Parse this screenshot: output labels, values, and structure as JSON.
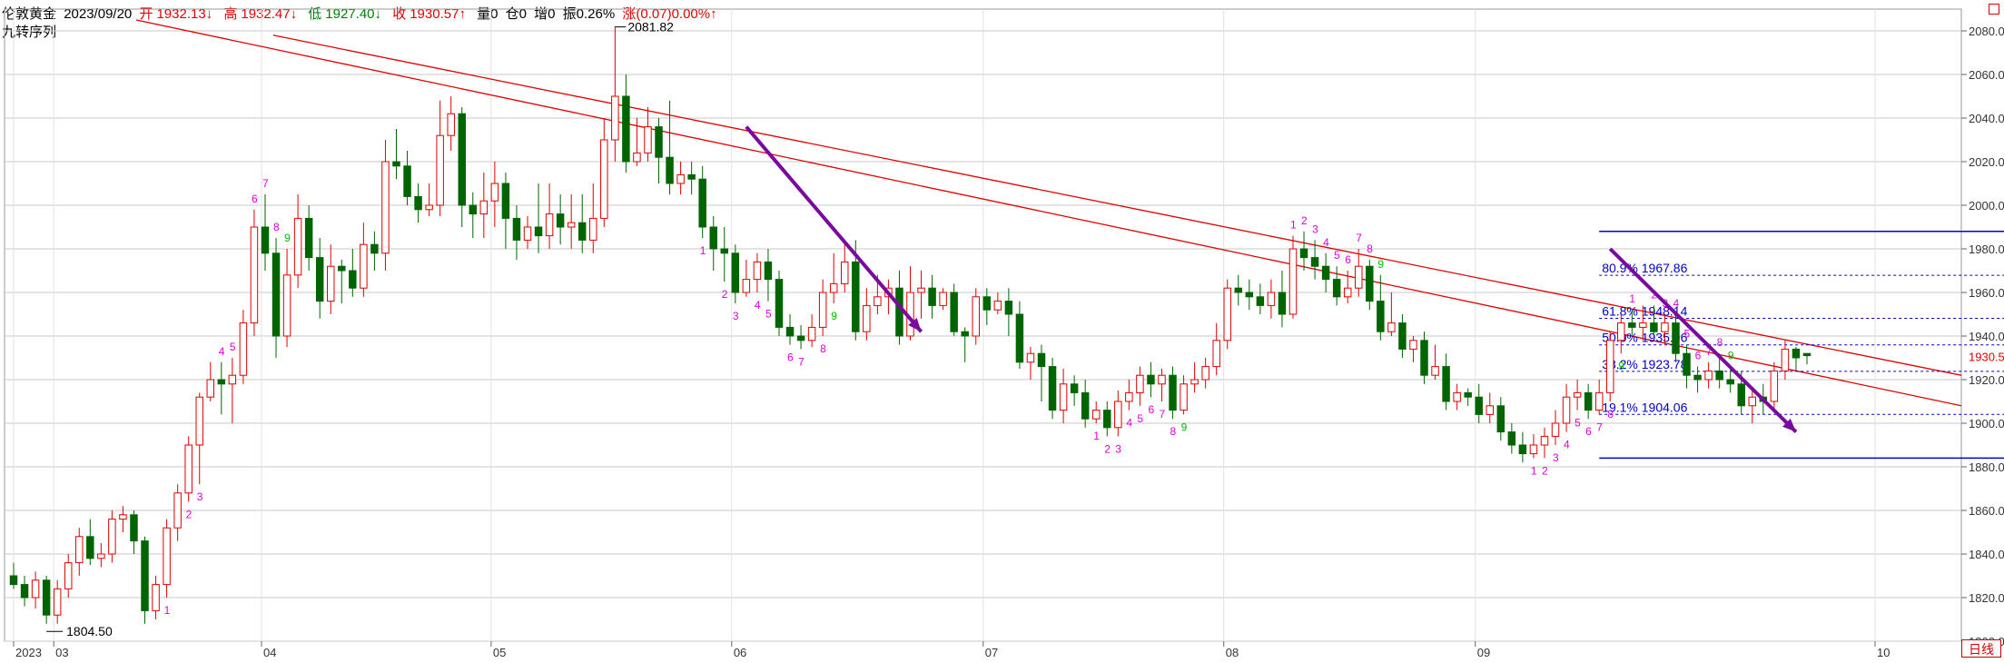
{
  "header": {
    "name": "伦敦黄金",
    "date": "2023/09/20",
    "open_label": "开",
    "open": "1932.13↓",
    "high_label": "高",
    "high": "1932.47↓",
    "low_label": "低",
    "low": "1927.40↓",
    "close_label": "收",
    "close": "1930.57↑",
    "volume": "量0",
    "position": "仓0",
    "increase": "增0",
    "amplitude": "振0.26%",
    "change": "涨(0.07)0.00%↑"
  },
  "indicator_name": "九转序列",
  "period_button": "日线",
  "colors": {
    "up": "#e00000",
    "down": "#006400",
    "trendline": "#e00000",
    "fib": "#0000cc",
    "arrow": "#7a0a9e",
    "td_up": "#e000e0",
    "td_down": "#00c000",
    "grid": "#c8c8c8"
  },
  "chart_data": {
    "type": "candlestick",
    "title": "伦敦黄金",
    "ylim": [
      1800,
      2090
    ],
    "y_ticks": [
      "1800.00",
      "1820.00",
      "1840.00",
      "1860.00",
      "1880.00",
      "1900.00",
      "1920.00",
      "1940.00",
      "1960.00",
      "1980.00",
      "2000.00",
      "2020.00",
      "2040.00",
      "2060.00",
      "2080.00"
    ],
    "x_ticks": [
      "2023",
      "03",
      "04",
      "05",
      "06",
      "07",
      "08",
      "09",
      "10"
    ],
    "last_price": "1930.57",
    "annotations": {
      "high_marker": "2081.82",
      "low_marker": "1804.50"
    },
    "fibonacci": [
      {
        "label": "80.9% 1967.86",
        "value": 1967.86
      },
      {
        "label": "61.8% 1948.14",
        "value": 1948.14
      },
      {
        "label": "50.0% 1935.96",
        "value": 1935.96
      },
      {
        "label": "38.2% 1923.78",
        "value": 1923.78
      },
      {
        "label": "19.1% 1904.06",
        "value": 1904.06
      }
    ],
    "fib_bounds": [
      1884,
      1988
    ],
    "candles": [
      [
        1830,
        1826,
        1836,
        1824
      ],
      [
        1826,
        1820,
        1830,
        1816
      ],
      [
        1820,
        1828,
        1832,
        1815
      ],
      [
        1828,
        1812,
        1830,
        1808
      ],
      [
        1812,
        1824,
        1828,
        1808
      ],
      [
        1824,
        1836,
        1840,
        1820
      ],
      [
        1836,
        1848,
        1852,
        1830
      ],
      [
        1848,
        1838,
        1856,
        1835
      ],
      [
        1838,
        1840,
        1845,
        1834
      ],
      [
        1840,
        1856,
        1860,
        1836
      ],
      [
        1856,
        1858,
        1862,
        1850
      ],
      [
        1858,
        1846,
        1860,
        1840
      ],
      [
        1846,
        1814,
        1848,
        1808
      ],
      [
        1814,
        1826,
        1830,
        1810
      ],
      [
        1826,
        1852,
        1856,
        1820
      ],
      [
        1852,
        1868,
        1872,
        1846
      ],
      [
        1868,
        1890,
        1894,
        1864
      ],
      [
        1890,
        1912,
        1914,
        1872
      ],
      [
        1912,
        1920,
        1928,
        1910
      ],
      [
        1920,
        1918,
        1928,
        1904
      ],
      [
        1918,
        1922,
        1930,
        1900
      ],
      [
        1922,
        1946,
        1952,
        1918
      ],
      [
        1946,
        1990,
        1998,
        1940
      ],
      [
        1990,
        1978,
        2005,
        1970
      ],
      [
        1978,
        1940,
        1985,
        1930
      ],
      [
        1940,
        1968,
        1980,
        1935
      ],
      [
        1968,
        1994,
        2005,
        1962
      ],
      [
        1994,
        1976,
        2000,
        1970
      ],
      [
        1976,
        1956,
        1985,
        1948
      ],
      [
        1956,
        1972,
        1982,
        1950
      ],
      [
        1972,
        1970,
        1975,
        1955
      ],
      [
        1970,
        1962,
        1980,
        1958
      ],
      [
        1962,
        1982,
        1992,
        1958
      ],
      [
        1982,
        1978,
        1988,
        1970
      ],
      [
        1978,
        2020,
        2030,
        1970
      ],
      [
        2020,
        2018,
        2035,
        2012
      ],
      [
        2018,
        2004,
        2025,
        2000
      ],
      [
        2004,
        1998,
        2010,
        1992
      ],
      [
        1998,
        2000,
        2010,
        1995
      ],
      [
        2000,
        2032,
        2048,
        1995
      ],
      [
        2032,
        2042,
        2050,
        2025
      ],
      [
        2042,
        2000,
        2045,
        1990
      ],
      [
        2000,
        1996,
        2006,
        1985
      ],
      [
        1996,
        2002,
        2015,
        1985
      ],
      [
        2002,
        2010,
        2020,
        1990
      ],
      [
        2010,
        1994,
        2015,
        1980
      ],
      [
        1994,
        1984,
        2000,
        1975
      ],
      [
        1984,
        1990,
        1995,
        1980
      ],
      [
        1990,
        1986,
        2010,
        1978
      ],
      [
        1986,
        1996,
        2010,
        1980
      ],
      [
        1996,
        1990,
        2005,
        1982
      ],
      [
        1990,
        1992,
        2005,
        1980
      ],
      [
        1992,
        1984,
        2005,
        1978
      ],
      [
        1984,
        1994,
        2010,
        1978
      ],
      [
        1994,
        2030,
        2040,
        1990
      ],
      [
        2030,
        2050,
        2082,
        2020
      ],
      [
        2050,
        2020,
        2060,
        2015
      ],
      [
        2020,
        2024,
        2040,
        2018
      ],
      [
        2024,
        2036,
        2045,
        2020
      ],
      [
        2036,
        2022,
        2040,
        2010
      ],
      [
        2022,
        2010,
        2048,
        2005
      ],
      [
        2010,
        2014,
        2020,
        2005
      ],
      [
        2014,
        2012,
        2020,
        2005
      ],
      [
        2012,
        1990,
        2018,
        1985
      ],
      [
        1990,
        1980,
        1995,
        1970
      ],
      [
        1980,
        1978,
        1990,
        1965
      ],
      [
        1978,
        1960,
        1982,
        1955
      ],
      [
        1960,
        1966,
        1975,
        1958
      ],
      [
        1966,
        1974,
        1978,
        1960
      ],
      [
        1974,
        1966,
        1980,
        1956
      ],
      [
        1966,
        1944,
        1970,
        1940
      ],
      [
        1944,
        1940,
        1950,
        1936
      ],
      [
        1940,
        1938,
        1945,
        1934
      ],
      [
        1938,
        1944,
        1950,
        1935
      ],
      [
        1944,
        1960,
        1966,
        1940
      ],
      [
        1960,
        1964,
        1978,
        1955
      ],
      [
        1964,
        1974,
        1984,
        1960
      ],
      [
        1974,
        1942,
        1984,
        1938
      ],
      [
        1942,
        1954,
        1962,
        1938
      ],
      [
        1954,
        1958,
        1968,
        1950
      ],
      [
        1958,
        1962,
        1966,
        1950
      ],
      [
        1962,
        1940,
        1970,
        1936
      ],
      [
        1940,
        1960,
        1972,
        1938
      ],
      [
        1960,
        1962,
        1970,
        1948
      ],
      [
        1962,
        1954,
        1968,
        1948
      ],
      [
        1954,
        1960,
        1962,
        1952
      ],
      [
        1960,
        1942,
        1964,
        1940
      ],
      [
        1942,
        1940,
        1944,
        1928
      ],
      [
        1940,
        1958,
        1962,
        1936
      ],
      [
        1958,
        1952,
        1962,
        1945
      ],
      [
        1952,
        1956,
        1960,
        1950
      ],
      [
        1956,
        1950,
        1962,
        1940
      ],
      [
        1950,
        1928,
        1956,
        1925
      ],
      [
        1928,
        1932,
        1935,
        1920
      ],
      [
        1932,
        1926,
        1936,
        1910
      ],
      [
        1926,
        1906,
        1930,
        1902
      ],
      [
        1906,
        1918,
        1925,
        1900
      ],
      [
        1918,
        1914,
        1922,
        1908
      ],
      [
        1914,
        1902,
        1920,
        1898
      ],
      [
        1902,
        1906,
        1910,
        1900
      ],
      [
        1906,
        1898,
        1910,
        1894
      ],
      [
        1898,
        1910,
        1915,
        1894
      ],
      [
        1910,
        1914,
        1920,
        1906
      ],
      [
        1914,
        1922,
        1926,
        1908
      ],
      [
        1922,
        1918,
        1928,
        1912
      ],
      [
        1918,
        1922,
        1925,
        1910
      ],
      [
        1922,
        1906,
        1926,
        1902
      ],
      [
        1906,
        1918,
        1922,
        1904
      ],
      [
        1918,
        1920,
        1928,
        1914
      ],
      [
        1920,
        1926,
        1930,
        1916
      ],
      [
        1926,
        1938,
        1946,
        1922
      ],
      [
        1938,
        1962,
        1966,
        1934
      ],
      [
        1962,
        1960,
        1968,
        1954
      ],
      [
        1960,
        1958,
        1966,
        1952
      ],
      [
        1958,
        1954,
        1964,
        1950
      ],
      [
        1954,
        1960,
        1966,
        1948
      ],
      [
        1960,
        1950,
        1970,
        1944
      ],
      [
        1950,
        1980,
        1986,
        1948
      ],
      [
        1980,
        1976,
        1988,
        1970
      ],
      [
        1976,
        1972,
        1984,
        1966
      ],
      [
        1972,
        1966,
        1978,
        1960
      ],
      [
        1966,
        1958,
        1972,
        1954
      ],
      [
        1958,
        1962,
        1970,
        1955
      ],
      [
        1962,
        1972,
        1980,
        1958
      ],
      [
        1972,
        1956,
        1975,
        1952
      ],
      [
        1956,
        1942,
        1968,
        1938
      ],
      [
        1942,
        1946,
        1960,
        1940
      ],
      [
        1946,
        1934,
        1950,
        1930
      ],
      [
        1934,
        1938,
        1940,
        1928
      ],
      [
        1938,
        1922,
        1942,
        1918
      ],
      [
        1922,
        1926,
        1936,
        1920
      ],
      [
        1926,
        1910,
        1932,
        1906
      ],
      [
        1910,
        1914,
        1918,
        1906
      ],
      [
        1914,
        1912,
        1916,
        1908
      ],
      [
        1912,
        1904,
        1918,
        1900
      ],
      [
        1904,
        1908,
        1914,
        1900
      ],
      [
        1908,
        1896,
        1912,
        1892
      ],
      [
        1896,
        1890,
        1900,
        1886
      ],
      [
        1890,
        1886,
        1896,
        1882
      ],
      [
        1886,
        1890,
        1895,
        1884
      ],
      [
        1890,
        1894,
        1898,
        1884
      ],
      [
        1894,
        1900,
        1906,
        1890
      ],
      [
        1900,
        1912,
        1918,
        1896
      ],
      [
        1912,
        1914,
        1920,
        1906
      ],
      [
        1914,
        1906,
        1918,
        1902
      ],
      [
        1906,
        1914,
        1920,
        1904
      ],
      [
        1914,
        1938,
        1942,
        1910
      ],
      [
        1938,
        1946,
        1950,
        1932
      ],
      [
        1946,
        1944,
        1952,
        1940
      ],
      [
        1944,
        1946,
        1954,
        1938
      ],
      [
        1946,
        1942,
        1954,
        1940
      ],
      [
        1942,
        1946,
        1950,
        1936
      ],
      [
        1946,
        1932,
        1950,
        1928
      ],
      [
        1932,
        1922,
        1936,
        1916
      ],
      [
        1922,
        1920,
        1926,
        1914
      ],
      [
        1920,
        1924,
        1928,
        1916
      ],
      [
        1924,
        1920,
        1932,
        1916
      ],
      [
        1920,
        1918,
        1926,
        1914
      ],
      [
        1918,
        1908,
        1924,
        1904
      ],
      [
        1908,
        1912,
        1916,
        1900
      ],
      [
        1912,
        1910,
        1918,
        1904
      ],
      [
        1910,
        1924,
        1928,
        1906
      ],
      [
        1924,
        1934,
        1938,
        1920
      ],
      [
        1934,
        1930,
        1935,
        1924
      ],
      [
        1932,
        1931,
        1932,
        1927
      ]
    ],
    "trendlines": [
      {
        "from": [
          0,
          2085
        ],
        "to": [
          1,
          1908
        ]
      },
      {
        "from": [
          0.07,
          2078
        ],
        "to": [
          1,
          1922
        ]
      }
    ],
    "td_labels": [
      {
        "i": 14,
        "text": "1",
        "dir": "up",
        "pos": "below"
      },
      {
        "i": 16,
        "text": "2",
        "dir": "up",
        "pos": "below"
      },
      {
        "i": 17,
        "text": "3",
        "dir": "up",
        "pos": "below"
      },
      {
        "i": 19,
        "text": "4",
        "dir": "up",
        "pos": "above"
      },
      {
        "i": 20,
        "text": "5",
        "dir": "up",
        "pos": "above"
      },
      {
        "i": 22,
        "text": "6",
        "dir": "up",
        "pos": "above"
      },
      {
        "i": 23,
        "text": "7",
        "dir": "up",
        "pos": "above"
      },
      {
        "i": 24,
        "text": "8",
        "dir": "up",
        "pos": "above"
      },
      {
        "i": 25,
        "text": "9",
        "dir": "down",
        "pos": "above"
      },
      {
        "i": 63,
        "text": "1",
        "dir": "up",
        "pos": "below"
      },
      {
        "i": 65,
        "text": "2",
        "dir": "up",
        "pos": "below"
      },
      {
        "i": 66,
        "text": "3",
        "dir": "up",
        "pos": "below"
      },
      {
        "i": 68,
        "text": "4",
        "dir": "up",
        "pos": "below"
      },
      {
        "i": 69,
        "text": "5",
        "dir": "up",
        "pos": "below"
      },
      {
        "i": 71,
        "text": "6",
        "dir": "up",
        "pos": "below"
      },
      {
        "i": 72,
        "text": "7",
        "dir": "up",
        "pos": "below"
      },
      {
        "i": 74,
        "text": "8",
        "dir": "up",
        "pos": "below"
      },
      {
        "i": 75,
        "text": "9",
        "dir": "down",
        "pos": "below"
      },
      {
        "i": 99,
        "text": "1",
        "dir": "up",
        "pos": "below"
      },
      {
        "i": 100,
        "text": "2",
        "dir": "up",
        "pos": "below"
      },
      {
        "i": 101,
        "text": "3",
        "dir": "up",
        "pos": "below"
      },
      {
        "i": 102,
        "text": "4",
        "dir": "up",
        "pos": "below"
      },
      {
        "i": 103,
        "text": "5",
        "dir": "up",
        "pos": "below"
      },
      {
        "i": 104,
        "text": "6",
        "dir": "up",
        "pos": "below"
      },
      {
        "i": 105,
        "text": "7",
        "dir": "up",
        "pos": "below"
      },
      {
        "i": 106,
        "text": "8",
        "dir": "up",
        "pos": "below"
      },
      {
        "i": 107,
        "text": "9",
        "dir": "down",
        "pos": "below"
      },
      {
        "i": 117,
        "text": "1",
        "dir": "up",
        "pos": "above"
      },
      {
        "i": 118,
        "text": "2",
        "dir": "up",
        "pos": "above"
      },
      {
        "i": 119,
        "text": "3",
        "dir": "up",
        "pos": "above"
      },
      {
        "i": 120,
        "text": "4",
        "dir": "up",
        "pos": "above"
      },
      {
        "i": 121,
        "text": "5",
        "dir": "up",
        "pos": "above"
      },
      {
        "i": 122,
        "text": "6",
        "dir": "up",
        "pos": "above"
      },
      {
        "i": 123,
        "text": "7",
        "dir": "up",
        "pos": "above"
      },
      {
        "i": 124,
        "text": "8",
        "dir": "up",
        "pos": "above"
      },
      {
        "i": 125,
        "text": "9",
        "dir": "down",
        "pos": "above"
      },
      {
        "i": 139,
        "text": "1",
        "dir": "up",
        "pos": "below"
      },
      {
        "i": 140,
        "text": "2",
        "dir": "up",
        "pos": "below"
      },
      {
        "i": 141,
        "text": "3",
        "dir": "up",
        "pos": "below"
      },
      {
        "i": 142,
        "text": "4",
        "dir": "up",
        "pos": "below"
      },
      {
        "i": 143,
        "text": "5",
        "dir": "up",
        "pos": "below"
      },
      {
        "i": 144,
        "text": "6",
        "dir": "up",
        "pos": "below"
      },
      {
        "i": 145,
        "text": "7",
        "dir": "up",
        "pos": "below"
      },
      {
        "i": 146,
        "text": "8",
        "dir": "up",
        "pos": "below"
      },
      {
        "i": 147,
        "text": "9",
        "dir": "down",
        "pos": "below"
      },
      {
        "i": 148,
        "text": "1",
        "dir": "up",
        "pos": "above"
      },
      {
        "i": 150,
        "text": "2",
        "dir": "up",
        "pos": "above"
      },
      {
        "i": 151,
        "text": "3",
        "dir": "up",
        "pos": "above"
      },
      {
        "i": 152,
        "text": "4",
        "dir": "up",
        "pos": "above"
      },
      {
        "i": 153,
        "text": "5",
        "dir": "up",
        "pos": "above"
      },
      {
        "i": 154,
        "text": "6",
        "dir": "up",
        "pos": "above"
      },
      {
        "i": 155,
        "text": "7",
        "dir": "up",
        "pos": "above"
      },
      {
        "i": 156,
        "text": "8",
        "dir": "up",
        "pos": "above"
      },
      {
        "i": 157,
        "text": "9",
        "dir": "down",
        "pos": "above"
      }
    ],
    "arrows": [
      {
        "from": [
          67,
          2036
        ],
        "to": [
          83,
          1942
        ]
      },
      {
        "from": [
          146,
          1980
        ],
        "to": [
          163,
          1896
        ]
      },
      {
        "from": [
          196,
          1934
        ],
        "to": [
          200,
          1890
        ]
      }
    ]
  }
}
